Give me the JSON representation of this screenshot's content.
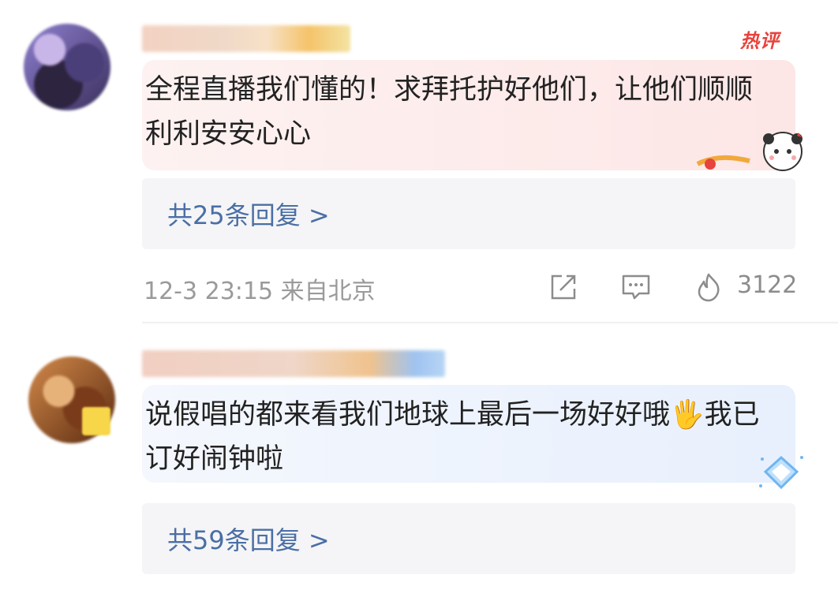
{
  "comments": [
    {
      "badge": "热评",
      "text": "全程直播我们懂的！求拜托护好他们，让他们顺顺利利安安心心",
      "replies_label": "共25条回复 >",
      "meta": "12-3 23:15 来自北京",
      "like_count": "3122"
    },
    {
      "text": "说假唱的都来看我们地球上最后一场好好哦🖐我已订好闹钟啦",
      "replies_label": "共59条回复 >"
    }
  ],
  "colors": {
    "reply_link": "#4a6fa5",
    "hot_badge": "#e8423c",
    "meta_text": "#9a9a9a"
  }
}
